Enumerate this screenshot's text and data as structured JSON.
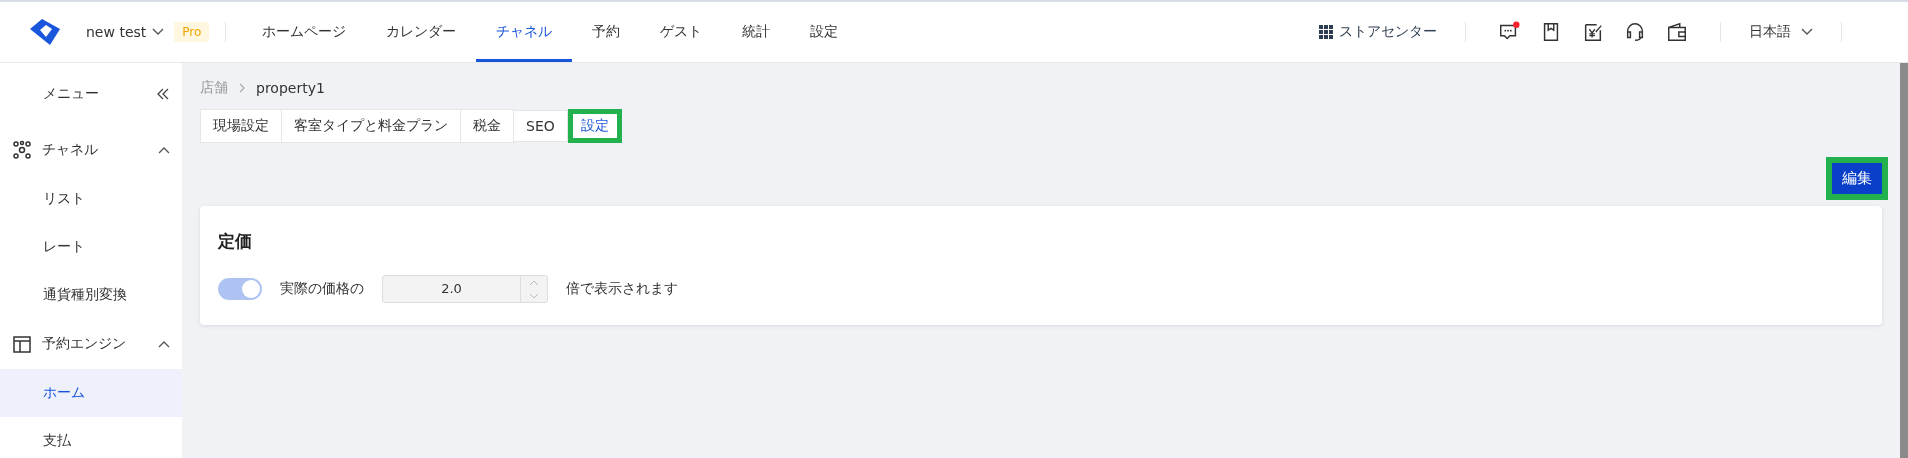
{
  "header": {
    "workspace": "new test",
    "plan_badge": "Pro",
    "nav": [
      {
        "label": "ホームページ",
        "selected": false
      },
      {
        "label": "カレンダー",
        "selected": false
      },
      {
        "label": "チャネル",
        "selected": true
      },
      {
        "label": "予約",
        "selected": false
      },
      {
        "label": "ゲスト",
        "selected": false
      },
      {
        "label": "統計",
        "selected": false
      },
      {
        "label": "設定",
        "selected": false
      }
    ],
    "store_center": "ストアセンター",
    "message_unread": true,
    "language": "日本語"
  },
  "sidebar": {
    "title": "メニュー",
    "groups": [
      {
        "label": "チャネル",
        "kind": "channels",
        "expanded": true,
        "children": [
          {
            "label": "リスト",
            "selected": false
          },
          {
            "label": "レート",
            "selected": false
          },
          {
            "label": "通貨種別変換",
            "selected": false
          }
        ]
      },
      {
        "label": "予約エンジン",
        "kind": "layout",
        "expanded": true,
        "children": [
          {
            "label": "ホーム",
            "selected": true
          },
          {
            "label": "支払",
            "selected": false
          }
        ]
      }
    ]
  },
  "breadcrumb": [
    "店舗",
    "property1"
  ],
  "tabs": [
    {
      "label": "現場設定",
      "selected": false,
      "highlighted": false
    },
    {
      "label": "客室タイプと料金プラン",
      "selected": false,
      "highlighted": false
    },
    {
      "label": "税金",
      "selected": false,
      "highlighted": false
    },
    {
      "label": "SEO",
      "selected": false,
      "highlighted": false
    },
    {
      "label": "設定",
      "selected": true,
      "highlighted": true
    }
  ],
  "edit_button": {
    "label": "編集",
    "highlighted": true
  },
  "card": {
    "title": "定価",
    "switch_on": true,
    "disabled": true,
    "label_before": "実際の価格の",
    "value": "2.0",
    "label_after": "倍で表示されます"
  }
}
